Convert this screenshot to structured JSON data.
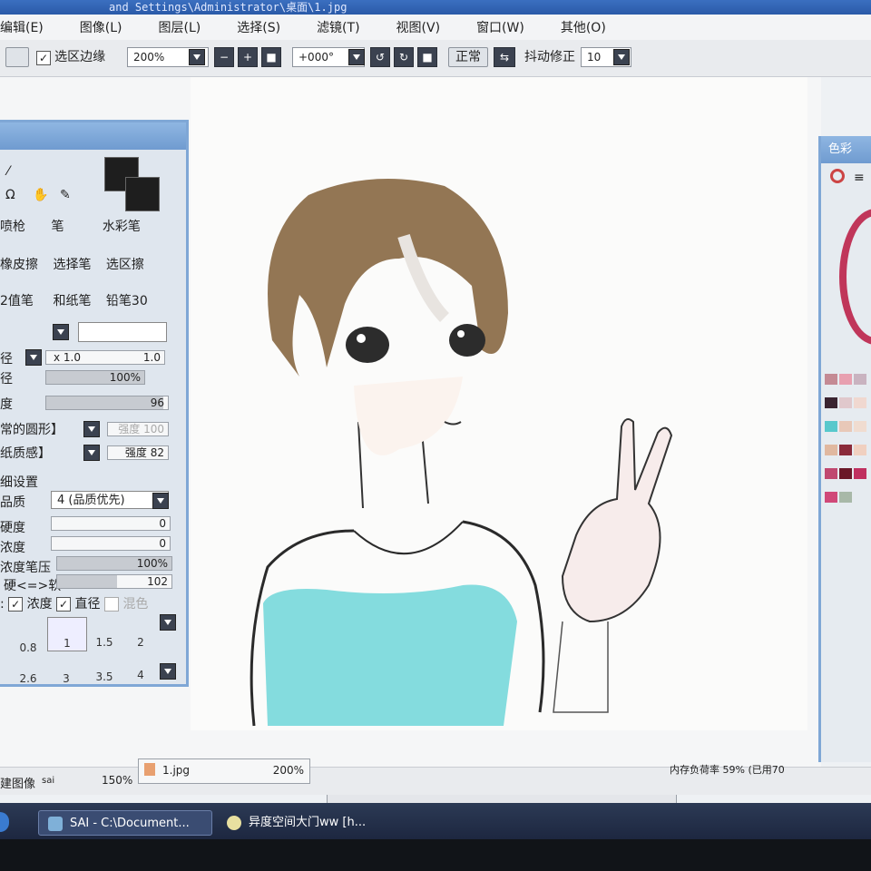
{
  "window": {
    "title_fragment": "and Settings\\Administrator\\桌面\\1.jpg"
  },
  "menu": [
    "编辑(E)",
    "图像(L)",
    "图层(L)",
    "选择(S)",
    "滤镜(T)",
    "视图(V)",
    "窗口(W)",
    "其他(O)"
  ],
  "toolbar": {
    "selection_edge_label": "选区边缘",
    "selection_edge_checked": "✓",
    "zoom_value": "200%",
    "rotation_value": "+000°",
    "normal_label": "正常",
    "stabilizer_label": "抖动修正",
    "stabilizer_value": "10"
  },
  "tool_panel": {
    "brush_row1": [
      "喷枪",
      "笔",
      "水彩笔"
    ],
    "brush_row2": [
      "橡皮擦",
      "选择笔",
      "选区擦"
    ],
    "brush_row3": [
      "2值笔",
      "和纸笔",
      "铅笔30"
    ],
    "size_label": "径",
    "size_multiplier": "x 1.0",
    "size_value": "1.0",
    "min_size_label": "径",
    "min_size_value": "100%",
    "density_label": "度",
    "density_value": "96",
    "shape_value": "常的圆形】",
    "shape_strength_label": "强度",
    "shape_strength_value": "100",
    "texture_value": "纸质感】",
    "texture_strength_label": "强度",
    "texture_strength_value": "82",
    "detail_label": "细设置",
    "quality_label": "品质",
    "quality_value": "4 (品质优先)",
    "hardness_label": "硬度",
    "hardness_value": "0",
    "min_density_label": "浓度",
    "min_density_value": "0",
    "pressure_label": "浓度笔压",
    "pressure_value": "100%",
    "hard_soft_label": "硬<=>软",
    "hard_soft_value": "102",
    "options_prefix": ":",
    "opt_density": "浓度",
    "opt_size": "直径",
    "opt_blend": "混色",
    "size_grid_row1": [
      "0.8",
      "1",
      "1.5",
      "2"
    ],
    "size_grid_row2": [
      "2.6",
      "3",
      "3.5",
      "4"
    ]
  },
  "color_panel": {
    "title": "色彩",
    "palette_colors": [
      "#c48a94",
      "#e8a0b0",
      "#c9b3c0",
      "#3a2430",
      "#e0c8cc",
      "#f0d8d0",
      "#58c8cc",
      "#e8c8b8",
      "#f0dcd0",
      "#e0b8a0",
      "#8a2a3a",
      "#f0d0c0",
      "#c04870",
      "#6a1828",
      "#c03060",
      "#d04878",
      "#a8b8a8"
    ]
  },
  "documents": {
    "left_doc_name": "建图像",
    "left_doc_tag": "sai",
    "left_doc_zoom": "150%",
    "active_doc_name": "1.jpg",
    "active_doc_zoom": "200%",
    "memory_text": "内存负荷率 59% (已用70"
  },
  "taskbar": {
    "task1": "SAI - C:\\Document...",
    "task2": "异度空间大门ww [h..."
  },
  "colors": {
    "accent_blue": "#7fa7d6",
    "dark_button": "#3b4250",
    "hair": "#8a6a45",
    "shirt": "#6fd6d8"
  }
}
